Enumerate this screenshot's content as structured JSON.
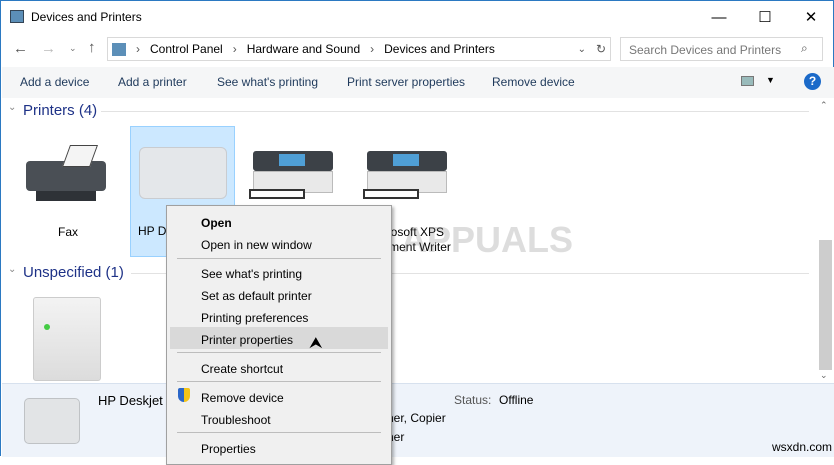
{
  "window": {
    "title": "Devices and Printers",
    "minimize": "—",
    "maximize": "☐",
    "close": "✕"
  },
  "address": {
    "crumbs": [
      "Control Panel",
      "Hardware and Sound",
      "Devices and Printers"
    ],
    "search_placeholder": "Search Devices and Printers"
  },
  "toolbar": {
    "items": [
      "Add a device",
      "Add a printer",
      "See what's printing",
      "Print server properties",
      "Remove device"
    ],
    "help": "?"
  },
  "groups": {
    "printers": "Printers (4)",
    "unspecified": "Unspecified (1)"
  },
  "devices": {
    "fax": "Fax",
    "hp": "HP D",
    "xps_line1": "Microsoft XPS",
    "xps_line2": "Document Writer"
  },
  "menu": {
    "items": [
      "Open",
      "Open in new window",
      "See what's printing",
      "Set as default printer",
      "Printing preferences",
      "Printer properties",
      "Create shortcut",
      "Remove device",
      "Troubleshoot",
      "Properties"
    ]
  },
  "details": {
    "name": "HP Deskjet I",
    "status_label": "Status:",
    "status_value": "Offline",
    "line2": "ner, Copier",
    "line3": "ner"
  },
  "watermarks": {
    "appuals": "APPUALS",
    "site": "wsxdn.com"
  },
  "colors": {
    "accent": "#1e3287",
    "selection": "#cce8ff",
    "details_bg": "#eef3fa"
  }
}
